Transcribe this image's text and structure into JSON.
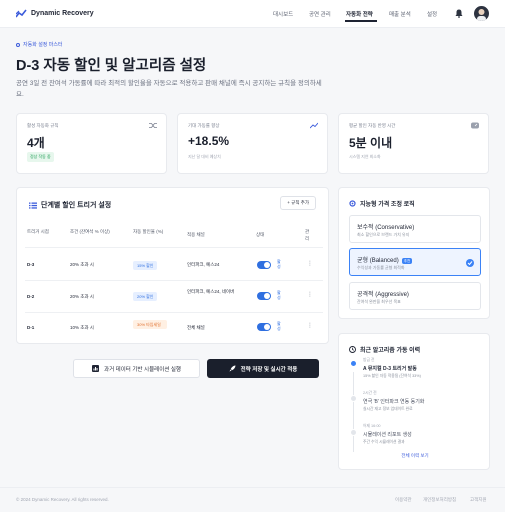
{
  "header": {
    "logo_text": "Dynamic Recovery",
    "nav": [
      "대시보드",
      "공연 관리",
      "자동화 전략",
      "매출 분석",
      "설정"
    ],
    "active_nav": "자동화 전략"
  },
  "page": {
    "breadcrumb": "자동화 설정 마스터",
    "title": "D-3 자동 할인 및 알고리즘 설정",
    "description": "공연 3일 전 잔여석 가동률에 따라 최적의 할인율을 자동으로 적용하고 판매 채널에 즉시 공지하는 규칙을 정의하세요."
  },
  "stats": [
    {
      "label": "활성 자동화 규칙",
      "value": "4개",
      "sub": "정상 작동 중",
      "icon": "shuffle-icon"
    },
    {
      "label": "기대 가동률 향상",
      "value": "+18.5%",
      "sub": "지난 달 대비 예상치",
      "icon": "trend-up-icon"
    },
    {
      "label": "평균 할인 자동 반영 시간",
      "value": "5분 이내",
      "sub": "시스템 지연 최소화",
      "icon": "speed-icon"
    }
  ],
  "triggers": {
    "title": "단계별 할인 트리거 설정",
    "add_label": "+ 규칙 추가",
    "columns": [
      "트리거 시점",
      "조건 (잔여석 % 이상)",
      "자동 할인율 (%)",
      "적용 채널",
      "상태",
      "관리"
    ],
    "rows": [
      {
        "time": "D-3",
        "cond": "20% 초과 시",
        "rate": "15% 할인",
        "channel": "인터파크, 예스24",
        "status": "활성"
      },
      {
        "time": "D-2",
        "cond": "20% 초과 시",
        "rate": "20% 할인",
        "channel": "인터파크, 예스24, 네이버",
        "status": "활성"
      },
      {
        "time": "D-1",
        "cond": "10% 초과 시",
        "rate": "30% 타임세일",
        "channel": "전체 채널",
        "status": "활성"
      }
    ]
  },
  "actions": {
    "simulate": "과거 데이터 기반 시뮬레이션 실행",
    "save": "전략 저장 및 실시간 적용"
  },
  "logic": {
    "title": "지능형 가격 조정 로직",
    "options": [
      {
        "name": "보수적 (Conservative)",
        "desc": "최소 할인으로 브랜드 가치 유지",
        "selected": false,
        "tag": ""
      },
      {
        "name": "균형 (Balanced)",
        "desc": "수익성과 가동률 균형 최적화",
        "selected": true,
        "tag": "추천"
      },
      {
        "name": "공격적 (Aggressive)",
        "desc": "잔여석 완판을 최우선 목표",
        "selected": false,
        "tag": ""
      }
    ]
  },
  "history": {
    "title": "최근 알고리즘 가동 이력",
    "items": [
      {
        "time": "방금 전",
        "title": "A 뮤지컬 D-3 트리거 발동",
        "sub": "15% 할인 자동 적용됨 (잔여석 33%)",
        "active": true
      },
      {
        "time": "2시간 전",
        "title": "연극 'B' 인터파크 연동 동기화",
        "sub": "실시간 재고 정보 업데이트 완료",
        "active": false
      },
      {
        "time": "어제 16:00",
        "title": "시뮬레이션 리포트 생성",
        "sub": "주간 수익 시뮬레이션 결과",
        "active": false
      }
    ],
    "view_all": "전체 이력 보기"
  },
  "footer": {
    "copyright": "© 2024 Dynamic Recovery. All rights reserved.",
    "links": [
      "이용약관",
      "개인정보처리방침",
      "고객지원"
    ]
  },
  "colors": {
    "accent": "#2f6fe0",
    "dark_button": "#1a1f2c",
    "green": "#1f9d55"
  }
}
